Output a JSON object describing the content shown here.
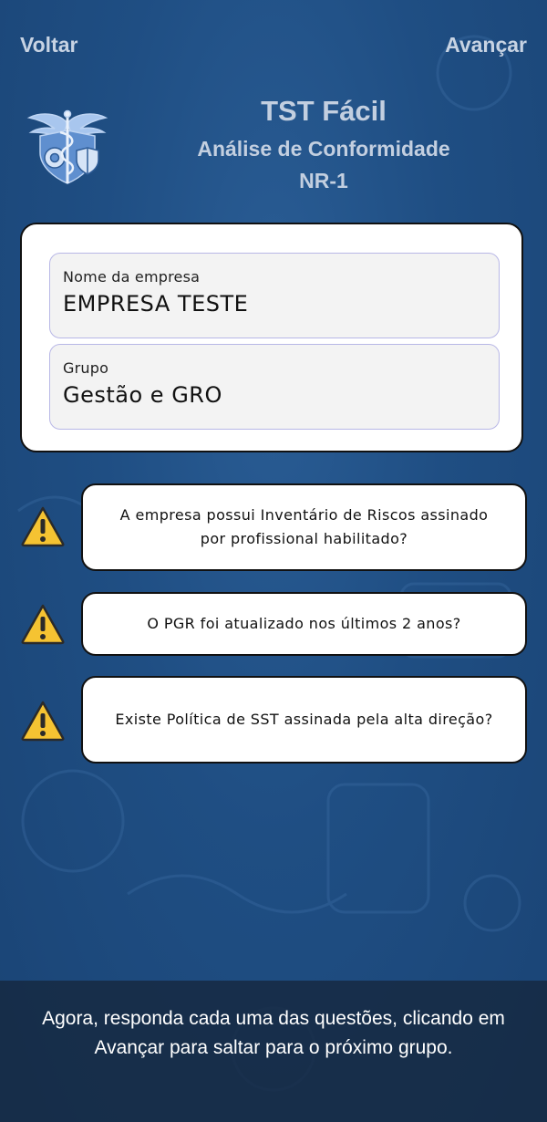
{
  "nav": {
    "back_label": "Voltar",
    "next_label": "Avançar"
  },
  "header": {
    "title": "TST Fácil",
    "subtitle": "Análise de Conformidade",
    "standard": "NR-1"
  },
  "form": {
    "company": {
      "label": "Nome da empresa",
      "value": "EMPRESA TESTE"
    },
    "group": {
      "label": "Grupo",
      "value": "Gestão e GRO"
    }
  },
  "questions": [
    {
      "text": "A empresa possui Inventário de Riscos assinado por profissional habilitado?",
      "icon": "warning-icon"
    },
    {
      "text": "O PGR foi atualizado nos últimos 2 anos?",
      "icon": "warning-icon"
    },
    {
      "text": "Existe Política de SST assinada pela alta direção?",
      "icon": "warning-icon"
    }
  ],
  "footer": {
    "instruction": "Agora, responda cada uma das questões, clicando em Avançar para saltar para o próximo grupo."
  },
  "colors": {
    "background": "#1f4e83",
    "header_text": "#c3cfe0",
    "warning": "#f5c332",
    "field_border": "#b8b7e6"
  }
}
